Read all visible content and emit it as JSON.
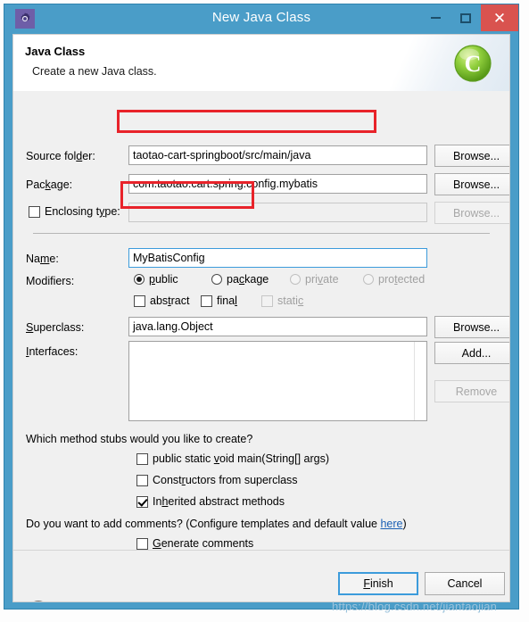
{
  "window": {
    "title": "New Java Class",
    "app_icon": "gear-icon",
    "minimize_label": "Minimize",
    "maximize_label": "Maximize",
    "close_label": "✕"
  },
  "header": {
    "title": "Java Class",
    "subtitle": "Create a new Java class.",
    "icon": "java-class-icon",
    "icon_letter": "C"
  },
  "form": {
    "source_folder": {
      "label": "Source folder:",
      "value": "taotao-cart-springboot/src/main/java",
      "browse": "Browse..."
    },
    "package": {
      "label": "Package:",
      "value": "com.taotao.cart.spring.config.mybatis",
      "browse": "Browse...",
      "highlighted": true
    },
    "enclosing_type": {
      "label": "Enclosing type:",
      "checked": false,
      "value": "",
      "browse": "Browse...",
      "disabled": true
    },
    "name": {
      "label": "Name:",
      "value": "MyBatisConfig",
      "highlighted": true,
      "focused": true
    },
    "modifiers": {
      "label": "Modifiers:",
      "radios": [
        {
          "label": "public",
          "selected": true,
          "disabled": false,
          "mnemonic": "p"
        },
        {
          "label": "package",
          "selected": false,
          "disabled": false,
          "mnemonic": "c"
        },
        {
          "label": "private",
          "selected": false,
          "disabled": true,
          "mnemonic": "v"
        },
        {
          "label": "protected",
          "selected": false,
          "disabled": true,
          "mnemonic": "t"
        }
      ],
      "checkboxes": [
        {
          "label": "abstract",
          "checked": false,
          "disabled": false
        },
        {
          "label": "final",
          "checked": false,
          "disabled": false
        },
        {
          "label": "static",
          "checked": false,
          "disabled": true
        }
      ]
    },
    "superclass": {
      "label": "Superclass:",
      "value": "java.lang.Object",
      "browse": "Browse..."
    },
    "interfaces": {
      "label": "Interfaces:",
      "items": [],
      "add": "Add...",
      "remove": "Remove",
      "remove_disabled": true
    }
  },
  "stubs": {
    "question": "Which method stubs would you like to create?",
    "options": [
      {
        "label": "public static void main(String[] args)",
        "checked": false
      },
      {
        "label": "Constructors from superclass",
        "checked": false
      },
      {
        "label": "Inherited abstract methods",
        "checked": true
      }
    ]
  },
  "comments": {
    "question_prefix": "Do you want to add comments? (Configure templates and default value ",
    "link": "here",
    "question_suffix": ")",
    "option": {
      "label": "Generate comments",
      "checked": false
    }
  },
  "footer": {
    "help": "?",
    "finish": "Finish",
    "cancel": "Cancel"
  },
  "watermark": "https://blog.csdn.net/jiantaojian",
  "colors": {
    "title_bar": "#4a9dc8",
    "close_button": "#d9534f",
    "annotation": "#e8232a",
    "focus": "#3c9bdb",
    "link": "#1a5fb4",
    "java_icon": "#7bc043"
  }
}
